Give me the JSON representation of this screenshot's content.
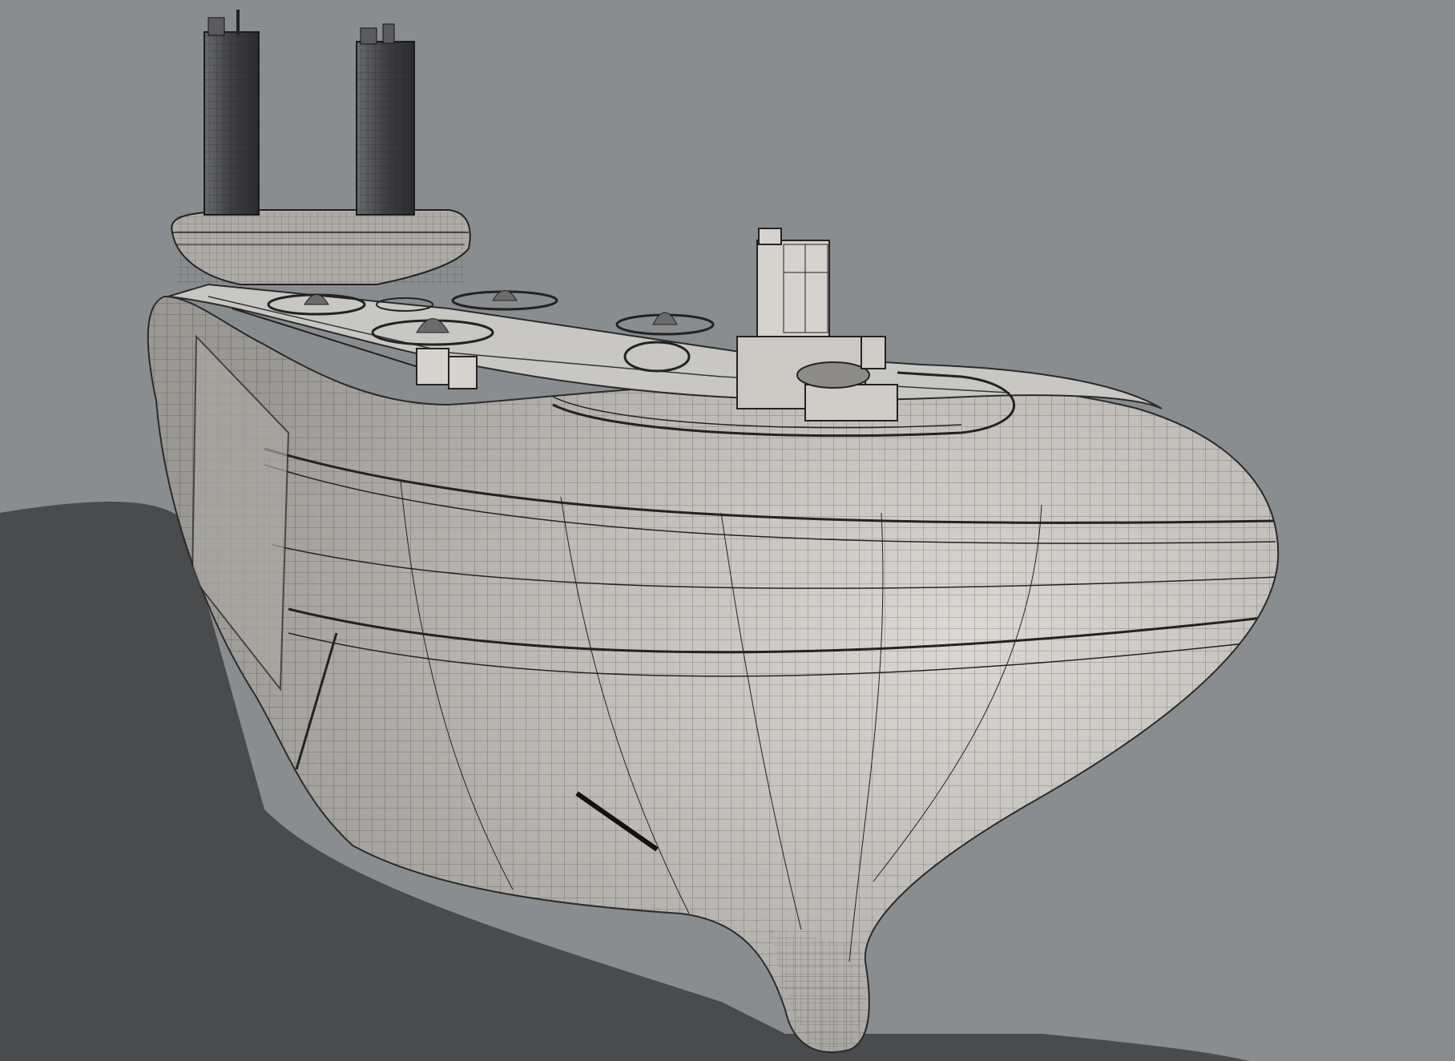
{
  "viewport": {
    "background": "#8a8d90",
    "ground_shadow": "#4a4b4d",
    "hull_fill": "#bdbab5",
    "hull_highlight": "#d8d5d0",
    "deck_fill": "#c9c7c3",
    "stack_fill": "#3e3f42",
    "wire_color": "#2a2a2a"
  },
  "model": {
    "subject": "ship-hull-wireframe-render",
    "smokestacks": 2,
    "rotor_pads": 6
  }
}
